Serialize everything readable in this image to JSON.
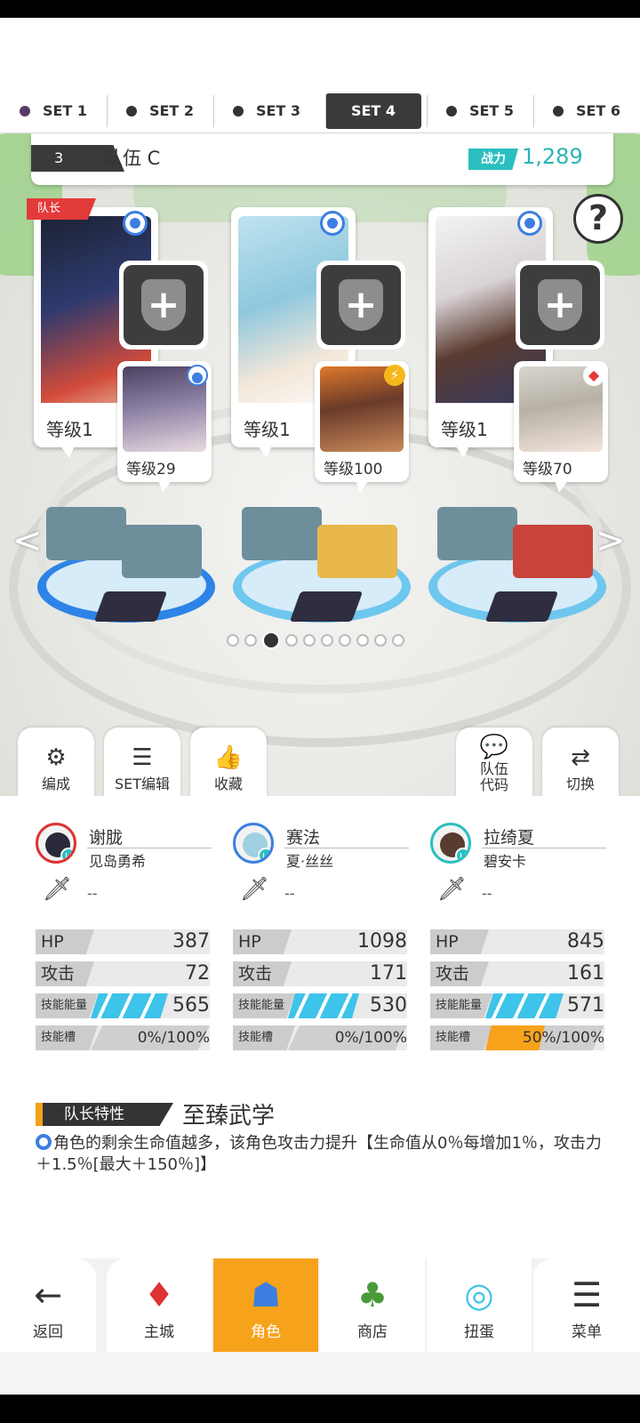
{
  "sets": [
    {
      "label": "SET 1",
      "dot": "#5a3a66",
      "active": false
    },
    {
      "label": "SET 2",
      "dot": "#333333",
      "active": false
    },
    {
      "label": "SET 3",
      "dot": "#333333",
      "active": false
    },
    {
      "label": "SET 4",
      "dot": "#333333",
      "active": true
    },
    {
      "label": "SET 5",
      "dot": "#333333",
      "active": false
    },
    {
      "label": "SET 6",
      "dot": "#333333",
      "active": false
    }
  ],
  "team": {
    "number": "3",
    "name": "队伍 C",
    "power_label": "战力",
    "power": "1,289",
    "help": "?",
    "leader_tag": "队长"
  },
  "slots": [
    {
      "main_level": "等级1",
      "sub_level": "等级29",
      "sub_mark": "●"
    },
    {
      "main_level": "等级1",
      "sub_level": "等级100",
      "sub_mark": "⚡"
    },
    {
      "main_level": "等级1",
      "sub_level": "等级70",
      "sub_mark": "◆"
    }
  ],
  "pager": {
    "count": 10,
    "active": 2
  },
  "tools": {
    "formation": "编成",
    "set_edit": "SET编辑",
    "favorite": "收藏",
    "team_code": "队伍\n代码",
    "switch": "切换"
  },
  "characters": [
    {
      "name": "谢胧",
      "sub": "见岛勇希",
      "weapon": "--",
      "hp": "387",
      "atk": "72",
      "skill_energy": "565",
      "skill_energy_fill": 0.65,
      "ult": "0%/100%",
      "ult_fill": 0.0
    },
    {
      "name": "赛法",
      "sub": "夏·丝丝",
      "weapon": "--",
      "hp": "1098",
      "atk": "171",
      "skill_energy": "530",
      "skill_energy_fill": 0.6,
      "ult": "0%/100%",
      "ult_fill": 0.0
    },
    {
      "name": "拉绮夏",
      "sub": "碧安卡",
      "weapon": "--",
      "hp": "845",
      "atk": "161",
      "skill_energy": "571",
      "skill_energy_fill": 0.66,
      "ult": "50%/100%",
      "ult_fill": 0.5
    }
  ],
  "stat_labels": {
    "hp": "HP",
    "atk": "攻击",
    "skill_energy": "技能能量",
    "ult": "技能槽"
  },
  "leader": {
    "label": "队长特性",
    "name": "至臻武学",
    "desc": "角色的剩余生命值越多，该角色攻击力提升【生命值从0％每增加1％，攻击力＋1.5％[最大＋150％]】"
  },
  "nav": [
    {
      "label": "返回",
      "icon": "back-arrow-icon",
      "glyph": "←",
      "active": false
    },
    {
      "label": "主城",
      "icon": "castle-icon",
      "glyph": "♦",
      "active": false
    },
    {
      "label": "角色",
      "icon": "character-icon",
      "glyph": "☗",
      "active": true
    },
    {
      "label": "商店",
      "icon": "shop-icon",
      "glyph": "♣",
      "active": false
    },
    {
      "label": "扭蛋",
      "icon": "gacha-icon",
      "glyph": "◎",
      "active": false
    },
    {
      "label": "菜单",
      "icon": "menu-icon",
      "glyph": "☰",
      "active": false
    }
  ],
  "colors": {
    "accent": "#f7a21b",
    "teal": "#2bbfbf",
    "blue": "#3c7fe0",
    "skill": "#3ec3ea"
  }
}
